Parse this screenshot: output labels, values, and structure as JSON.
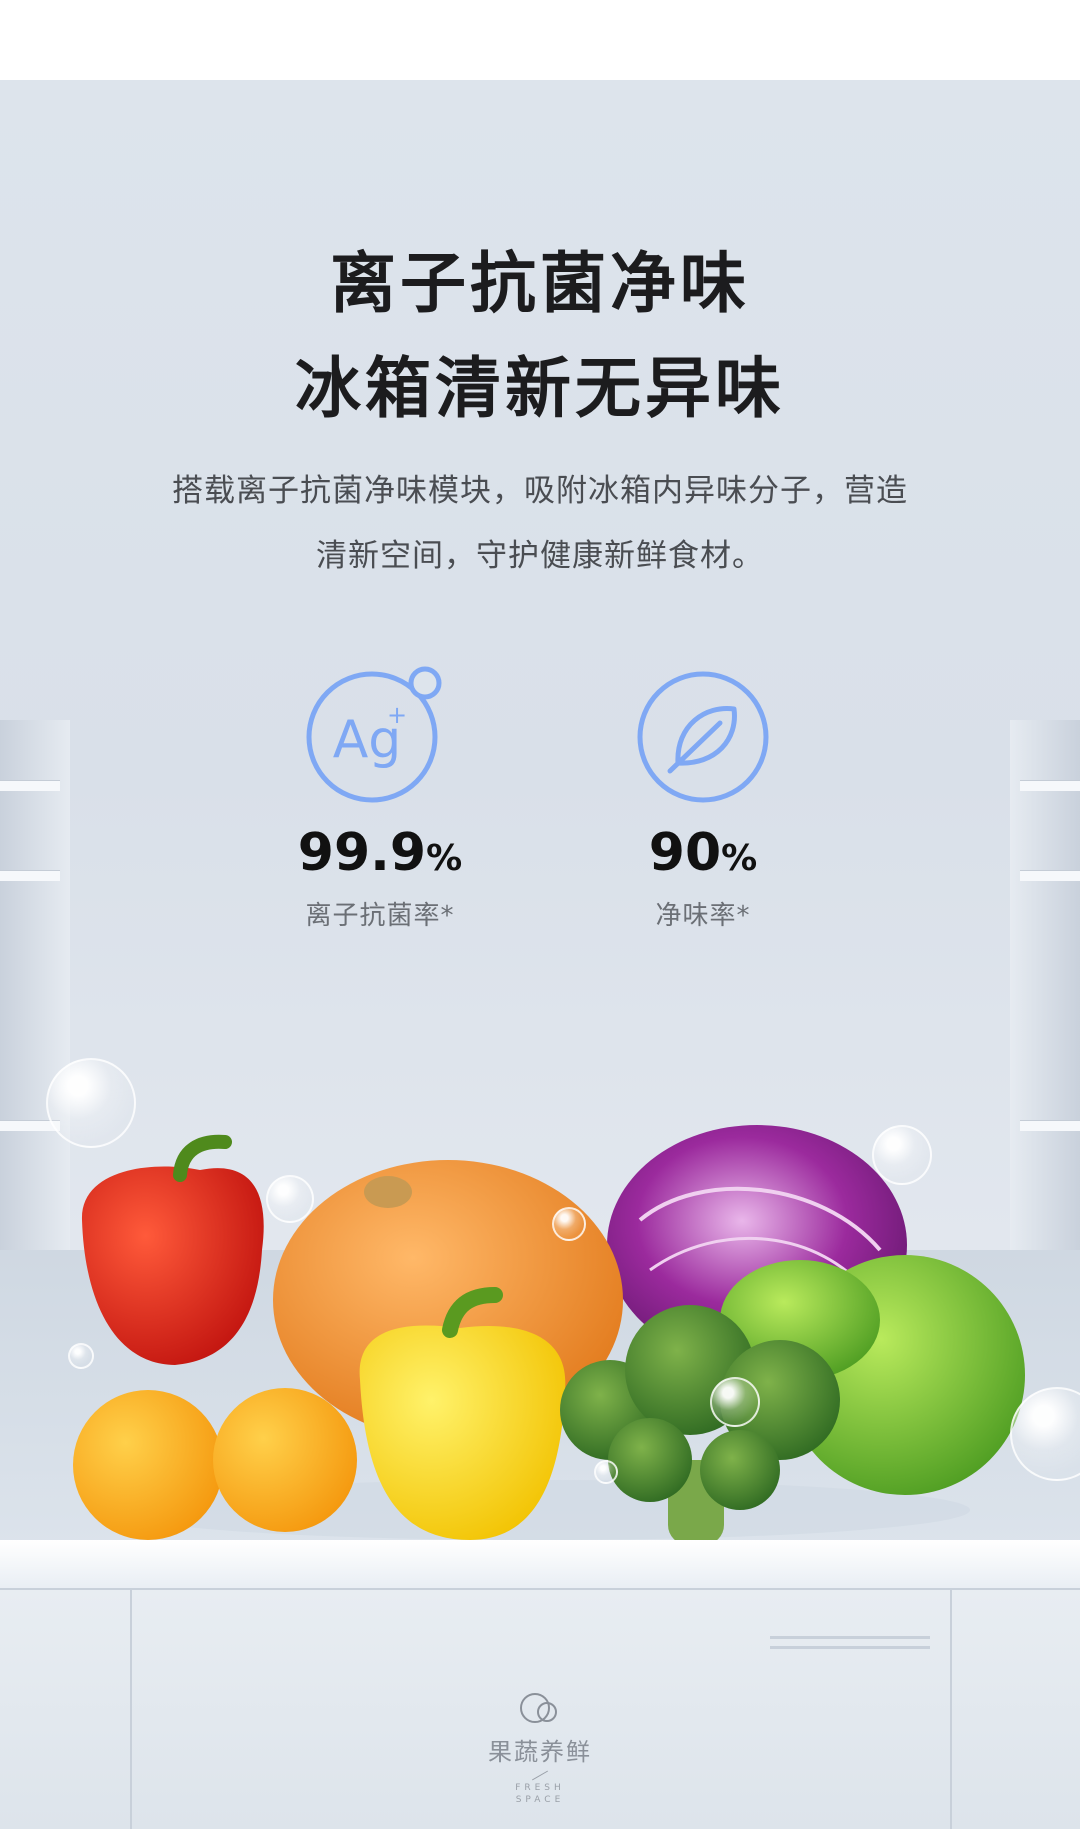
{
  "headline": {
    "line1": "离子抗菌净味",
    "line2": "冰箱清新无异味"
  },
  "description": {
    "line1": "搭载离子抗菌净味模块，吸附冰箱内异味分子，营造",
    "line2": "清新空间，守护健康新鲜食材。"
  },
  "stats": [
    {
      "icon": "silver-ion-ag-icon",
      "value": "99.9",
      "unit": "%",
      "label": "离子抗菌率*"
    },
    {
      "icon": "leaf-icon",
      "value": "90",
      "unit": "%",
      "label": "净味率*"
    }
  ],
  "badge": {
    "icon": "fruit-bowl-icon",
    "label_cn": "果蔬养鲜",
    "label_en_line1": "FRESH",
    "label_en_line2": "SPACE"
  },
  "colors": {
    "accent_icon": "#7fa8f4",
    "text_primary": "#1c1c1e",
    "text_secondary": "#6b6f75"
  }
}
